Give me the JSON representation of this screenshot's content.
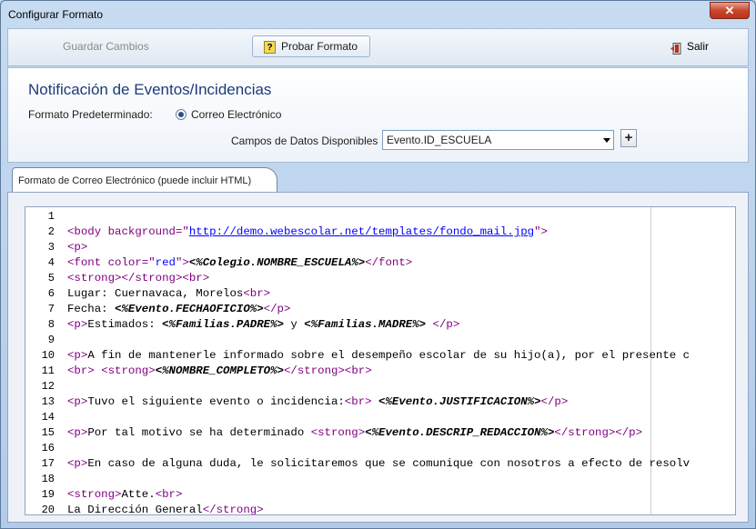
{
  "window": {
    "title": "Configurar Formato",
    "close_label": "✕"
  },
  "toolbar": {
    "save_label": "Guardar Cambios",
    "test_label": "Probar Formato",
    "test_icon": "?",
    "exit_label": "Salir"
  },
  "header": {
    "title": "Notificación de Eventos/Incidencias",
    "format_label": "Formato Predeterminado:",
    "format_option": "Correo Electrónico",
    "fields_label": "Campos de Datos Disponibles",
    "fields_value": "Evento.ID_ESCUELA",
    "add_label": "+"
  },
  "tab": {
    "label": "Formato de Correo Electrónico (puede incluir HTML)"
  },
  "editor": {
    "colors": {
      "tag": "#800080",
      "attr": "#0000ff",
      "string": "#0000ff",
      "field": "#000000",
      "text": "#000000"
    },
    "lines": [
      {
        "n": "1",
        "text": ""
      },
      {
        "n": "2",
        "text": "<body background=\"http://demo.webescolar.net/templates/fondo_mail.jpg\">"
      },
      {
        "n": "3",
        "text": "<p>"
      },
      {
        "n": "4",
        "text": "<font color=\"red\"><%Colegio.NOMBRE_ESCUELA%></font>"
      },
      {
        "n": "5",
        "text": "<strong></strong><br>"
      },
      {
        "n": "6",
        "text": "Lugar: Cuernavaca, Morelos<br>"
      },
      {
        "n": "7",
        "text": "Fecha: <%Evento.FECHAOFICIO%></p>"
      },
      {
        "n": "8",
        "text": "<p>Estimados: <%Familias.PADRE%> y <%Familias.MADRE%> </p>"
      },
      {
        "n": "9",
        "text": ""
      },
      {
        "n": "10",
        "text": "<p>A fin de mantenerle informado sobre el desempeño escolar de su hijo(a), por el presente c"
      },
      {
        "n": "11",
        "text": "<br> <strong><%NOMBRE_COMPLETO%></strong><br>"
      },
      {
        "n": "12",
        "text": ""
      },
      {
        "n": "13",
        "text": "<p>Tuvo el siguiente evento o incidencia:<br> <%Evento.JUSTIFICACION%></p>"
      },
      {
        "n": "14",
        "text": ""
      },
      {
        "n": "15",
        "text": "<p>Por tal motivo se ha determinado <strong><%Evento.DESCRIP_REDACCION%></strong></p>"
      },
      {
        "n": "16",
        "text": ""
      },
      {
        "n": "17",
        "text": "<p>En caso de alguna duda, le solicitaremos que se comunique con nosotros a efecto de resolv"
      },
      {
        "n": "18",
        "text": ""
      },
      {
        "n": "19",
        "text": "<strong>Atte.<br>"
      },
      {
        "n": "20",
        "text": "La Dirección General</strong>"
      }
    ]
  }
}
